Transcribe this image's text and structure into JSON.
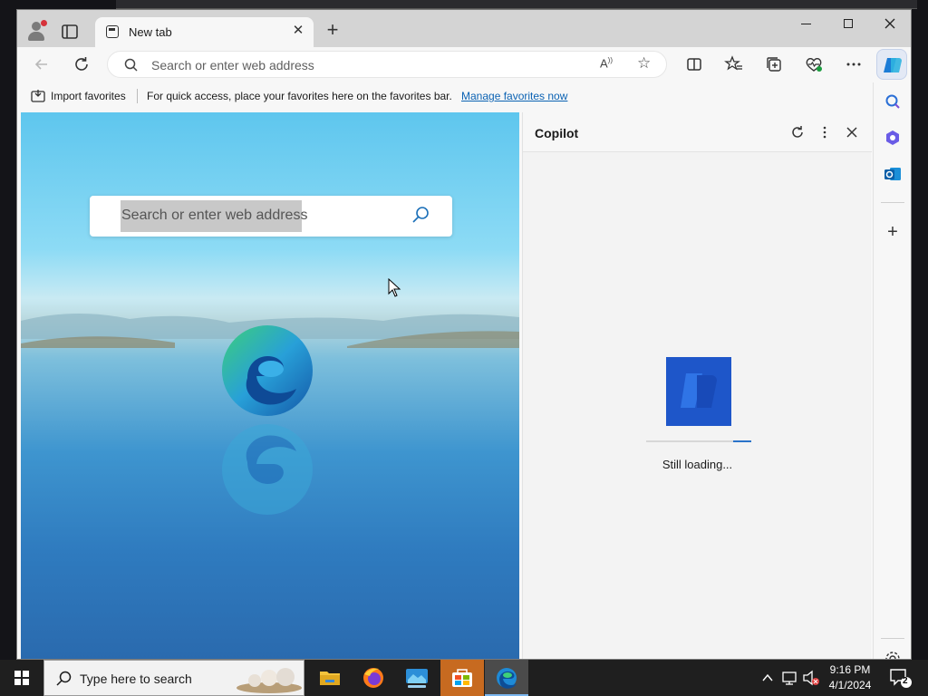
{
  "browser": {
    "tab": {
      "title": "New tab"
    },
    "address_bar": {
      "placeholder": "Search or enter web address",
      "value": ""
    },
    "favorites_bar": {
      "import_label": "Import favorites",
      "hint_text": "For quick access, place your favorites here on the favorites bar.",
      "manage_link": "Manage favorites now"
    }
  },
  "newtab_page": {
    "search_placeholder": "Search or enter web address"
  },
  "copilot_pane": {
    "title": "Copilot",
    "status": "Still loading...",
    "progress": 0.17
  },
  "taskbar": {
    "search_label": "Type here to search",
    "time": "9:16 PM",
    "date": "4/1/2024",
    "notification_count": "2"
  },
  "colors": {
    "accent": "#0b62b3",
    "copilot_logo": "#1e56c9",
    "store_tile": "#c76a20"
  }
}
